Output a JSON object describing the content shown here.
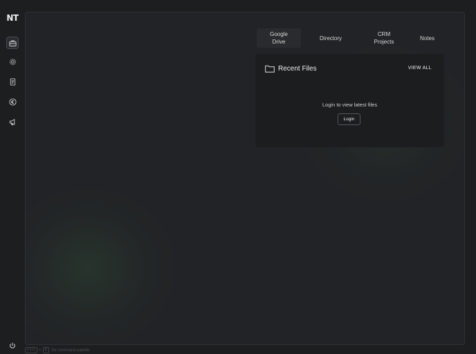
{
  "sidebar": {
    "logo": "NT",
    "items": [
      {
        "icon": "briefcase-icon",
        "active": true
      },
      {
        "icon": "gear-icon",
        "active": false
      },
      {
        "icon": "document-icon",
        "active": false
      },
      {
        "icon": "euro-icon",
        "active": false
      },
      {
        "icon": "megaphone-icon",
        "active": false
      }
    ],
    "power_icon": "power-icon"
  },
  "tabs": [
    {
      "label_line1": "Google",
      "label_line2": "Drive",
      "active": true
    },
    {
      "label_line1": "Directory",
      "label_line2": "",
      "active": false
    },
    {
      "label_line1": "CRM",
      "label_line2": "Projects",
      "active": false
    },
    {
      "label_line1": "Notes",
      "label_line2": "",
      "active": false
    }
  ],
  "card": {
    "title": "Recent Files",
    "view_all": "VIEW ALL",
    "empty_message": "Login to view latest files",
    "login_label": "Login"
  },
  "footer": {
    "key1": "Ctrl",
    "plus": "+",
    "key2": "K",
    "hint": "for command palette"
  },
  "colors": {
    "background": "#1d1e20",
    "panel": "#222326",
    "card": "#1c1d1f",
    "glow": "#3c6e46"
  }
}
